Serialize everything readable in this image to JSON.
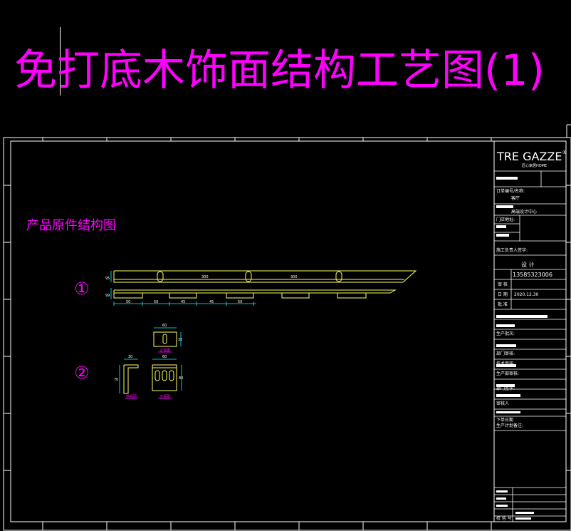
{
  "title": "免打底木饰面结构工艺图(1)",
  "subtitle": "产品原件结构图",
  "markers": [
    "①",
    "②"
  ],
  "title_block": {
    "logo": "TRE GAZZE",
    "logo_mark": "®",
    "logo_sub": "匠心家居HOME",
    "fields": [
      "订单编号/名称:",
      "客厅",
      "高端设计中心",
      "门店地址:",
      "施工负责人签字:",
      "设 计",
      "13585323006",
      "审 核",
      "日 期",
      "2020.12.30",
      "批 准",
      "生产批次:",
      "部门审核:",
      "技术审核:",
      "生产部审核:",
      "部门签字:",
      "审核人",
      "下单日期",
      "生产计划备注:",
      "校 色 号"
    ]
  },
  "dimensions": {
    "profile1": [
      "300",
      "300",
      "95",
      "99"
    ],
    "spacing": [
      "50",
      "50",
      "45",
      "45",
      "50"
    ],
    "part_a": [
      "60",
      "30"
    ],
    "part_b": [
      "30",
      "70"
    ],
    "part_c": [
      "60",
      "80"
    ],
    "part_labels": [
      "正视图",
      "侧视图",
      "正视图"
    ]
  }
}
